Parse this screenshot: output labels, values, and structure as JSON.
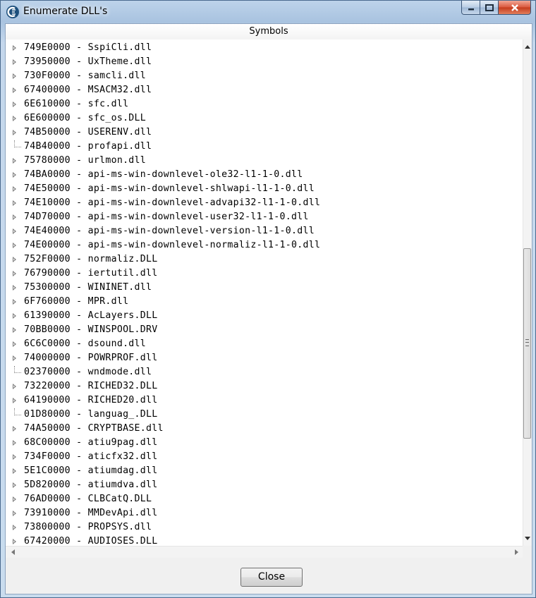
{
  "window": {
    "title": "Enumerate DLL's",
    "caption_buttons": [
      "minimize",
      "maximize",
      "close"
    ]
  },
  "header": {
    "label": "Symbols"
  },
  "modules": [
    {
      "text": "749E0000 - SspiCli.dll",
      "expandable": true
    },
    {
      "text": "73950000 - UxTheme.dll",
      "expandable": true
    },
    {
      "text": "730F0000 - samcli.dll",
      "expandable": true
    },
    {
      "text": "67400000 - MSACM32.dll",
      "expandable": true
    },
    {
      "text": "6E610000 - sfc.dll",
      "expandable": true
    },
    {
      "text": "6E600000 - sfc_os.DLL",
      "expandable": true
    },
    {
      "text": "74B50000 - USERENV.dll",
      "expandable": true
    },
    {
      "text": "74B40000 - profapi.dll",
      "expandable": false
    },
    {
      "text": "75780000 - urlmon.dll",
      "expandable": true
    },
    {
      "text": "74BA0000 - api-ms-win-downlevel-ole32-l1-1-0.dll",
      "expandable": true
    },
    {
      "text": "74E50000 - api-ms-win-downlevel-shlwapi-l1-1-0.dll",
      "expandable": true
    },
    {
      "text": "74E10000 - api-ms-win-downlevel-advapi32-l1-1-0.dll",
      "expandable": true
    },
    {
      "text": "74D70000 - api-ms-win-downlevel-user32-l1-1-0.dll",
      "expandable": true
    },
    {
      "text": "74E40000 - api-ms-win-downlevel-version-l1-1-0.dll",
      "expandable": true
    },
    {
      "text": "74E00000 - api-ms-win-downlevel-normaliz-l1-1-0.dll",
      "expandable": true
    },
    {
      "text": "752F0000 - normaliz.DLL",
      "expandable": true
    },
    {
      "text": "76790000 - iertutil.dll",
      "expandable": true
    },
    {
      "text": "75300000 - WININET.dll",
      "expandable": true
    },
    {
      "text": "6F760000 - MPR.dll",
      "expandable": true
    },
    {
      "text": "61390000 - AcLayers.DLL",
      "expandable": true
    },
    {
      "text": "70BB0000 - WINSPOOL.DRV",
      "expandable": true
    },
    {
      "text": "6C6C0000 - dsound.dll",
      "expandable": true
    },
    {
      "text": "74000000 - POWRPROF.dll",
      "expandable": true
    },
    {
      "text": "02370000 - wndmode.dll",
      "expandable": false
    },
    {
      "text": "73220000 - RICHED32.DLL",
      "expandable": true
    },
    {
      "text": "64190000 - RICHED20.dll",
      "expandable": true
    },
    {
      "text": "01D80000 - languag_.DLL",
      "expandable": false
    },
    {
      "text": "74A50000 - CRYPTBASE.dll",
      "expandable": true
    },
    {
      "text": "68C00000 - atiu9pag.dll",
      "expandable": true
    },
    {
      "text": "734F0000 - aticfx32.dll",
      "expandable": true
    },
    {
      "text": "5E1C0000 - atiumdag.dll",
      "expandable": true
    },
    {
      "text": "5D820000 - atiumdva.dll",
      "expandable": true
    },
    {
      "text": "76AD0000 - CLBCatQ.DLL",
      "expandable": true
    },
    {
      "text": "73910000 - MMDevApi.dll",
      "expandable": true
    },
    {
      "text": "73800000 - PROPSYS.dll",
      "expandable": true
    },
    {
      "text": "67420000 - AUDIOSES.DLL",
      "expandable": true
    }
  ],
  "footer": {
    "close_label": "Close"
  },
  "icons": {
    "app": "cheat-engine-icon",
    "expander": "triangle-right-icon"
  },
  "colors": {
    "close_caption": "#c43a1b",
    "titlebar": "#a9c3e0"
  }
}
